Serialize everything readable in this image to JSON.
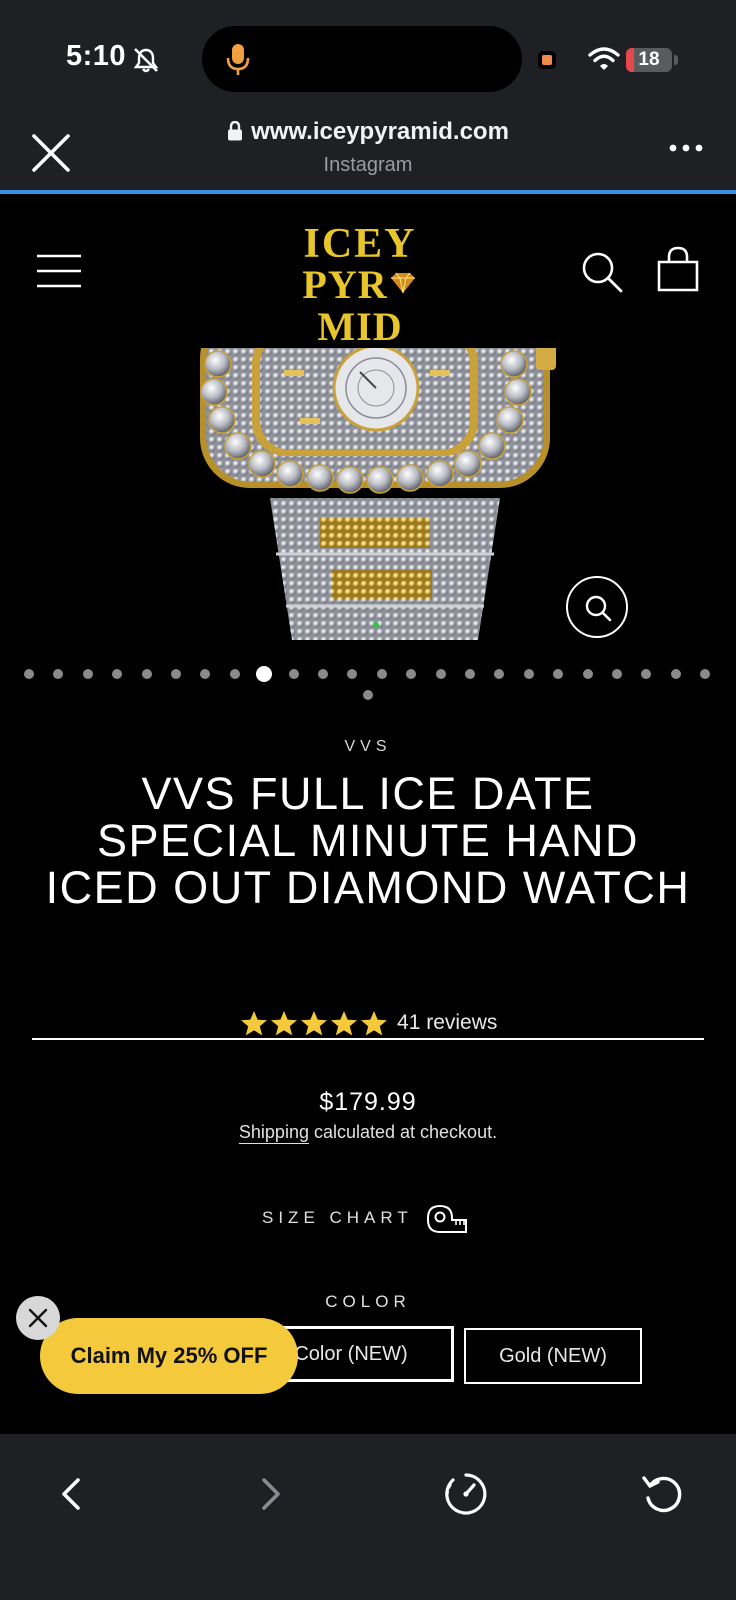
{
  "status_bar": {
    "time": "5:10",
    "battery": "18",
    "battery_level_percent": 18,
    "icons": [
      "bell-slash-icon",
      "microphone-icon",
      "recording-indicator",
      "wifi-icon",
      "battery-icon"
    ]
  },
  "browser": {
    "url": "www.iceypyramid.com",
    "source": "Instagram",
    "accent_color": "#3a8fe6",
    "icons": [
      "close-icon",
      "lock-icon",
      "more-icon"
    ]
  },
  "store": {
    "logo_line1": "ICEY",
    "logo_line2_left": "PYR",
    "logo_line2_right": "MID",
    "brand_color": "#e8c52b",
    "icons": [
      "hamburger-menu-icon",
      "search-icon",
      "shopping-bag-icon"
    ]
  },
  "gallery": {
    "total_images": 25,
    "active_index": 8,
    "zoom_icon": "zoom-in-icon"
  },
  "product": {
    "vendor": "VVS",
    "title": "VVS FULL ICE DATE SPECIAL MINUTE HAND ICED OUT DIAMOND WATCH",
    "rating_stars": 5,
    "reviews": "41 reviews",
    "star_color": "#f4c93c",
    "price": "$179.99",
    "shipping_link": "Shipping",
    "shipping_text": " calculated at checkout.",
    "size_chart": "SIZE CHART",
    "color_label": "COLOR",
    "colors": [
      {
        "label": "Color (NEW)",
        "selected": true
      },
      {
        "label": "Gold (NEW)",
        "selected": false
      }
    ]
  },
  "promo": {
    "label": "Claim My 25% OFF",
    "color": "#f4c93c"
  },
  "toolbar": {
    "icons": [
      "back-icon",
      "forward-icon",
      "speed-icon",
      "reload-icon"
    ]
  }
}
